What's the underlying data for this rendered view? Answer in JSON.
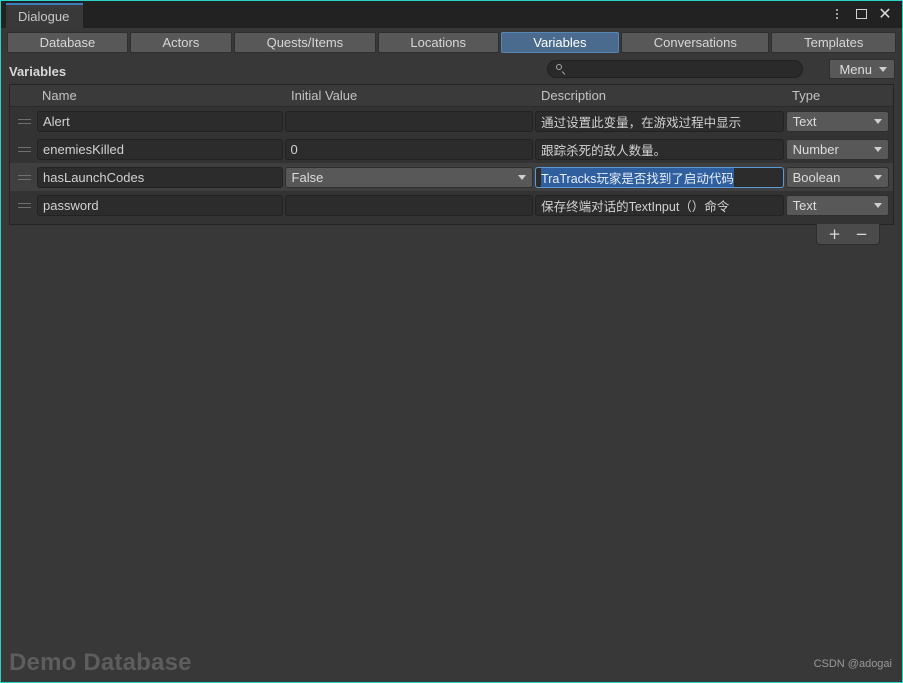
{
  "window": {
    "tab_title": "Dialogue",
    "controls": {
      "menu_label": "⋮",
      "maximize_label": "",
      "close_label": "✕"
    }
  },
  "tabs": [
    {
      "label": "Database",
      "active": false
    },
    {
      "label": "Actors",
      "active": false
    },
    {
      "label": "Quests/Items",
      "active": false
    },
    {
      "label": "Locations",
      "active": false
    },
    {
      "label": "Variables",
      "active": true
    },
    {
      "label": "Conversations",
      "active": false
    },
    {
      "label": "Templates",
      "active": false
    }
  ],
  "toolbar": {
    "section_title": "Variables",
    "search_value": "",
    "search_placeholder": "",
    "menu_label": "Menu"
  },
  "table": {
    "columns": [
      "Name",
      "Initial Value",
      "Description",
      "Type"
    ],
    "rows": [
      {
        "name": "Alert",
        "initial_value": "",
        "initial_is_dropdown": false,
        "description": "通过设置此变量，在游戏过程中显示",
        "type": "Text",
        "selected": false,
        "description_focused": false
      },
      {
        "name": "enemiesKilled",
        "initial_value": "0",
        "initial_is_dropdown": false,
        "description": "跟踪杀死的敌人数量。",
        "type": "Number",
        "selected": false,
        "description_focused": false
      },
      {
        "name": "hasLaunchCodes",
        "initial_value": "False",
        "initial_is_dropdown": true,
        "description": "TraTracks玩家是否找到了启动代码",
        "type": "Boolean",
        "selected": true,
        "description_focused": true
      },
      {
        "name": "password",
        "initial_value": "",
        "initial_is_dropdown": false,
        "description": "保存终端对话的TextInput（）命令",
        "type": "Text",
        "selected": false,
        "description_focused": false
      }
    ],
    "add_button_label": "+",
    "remove_button_label": "−"
  },
  "footer": {
    "database_label": "Demo Database",
    "watermark": "CSDN @adogai"
  },
  "colors": {
    "accent_border": "#2ad4c8",
    "active_tab": "#4a6b8e",
    "selection_blue": "#2f5f9e",
    "panel_bg": "#333333",
    "window_bg": "#383838"
  }
}
